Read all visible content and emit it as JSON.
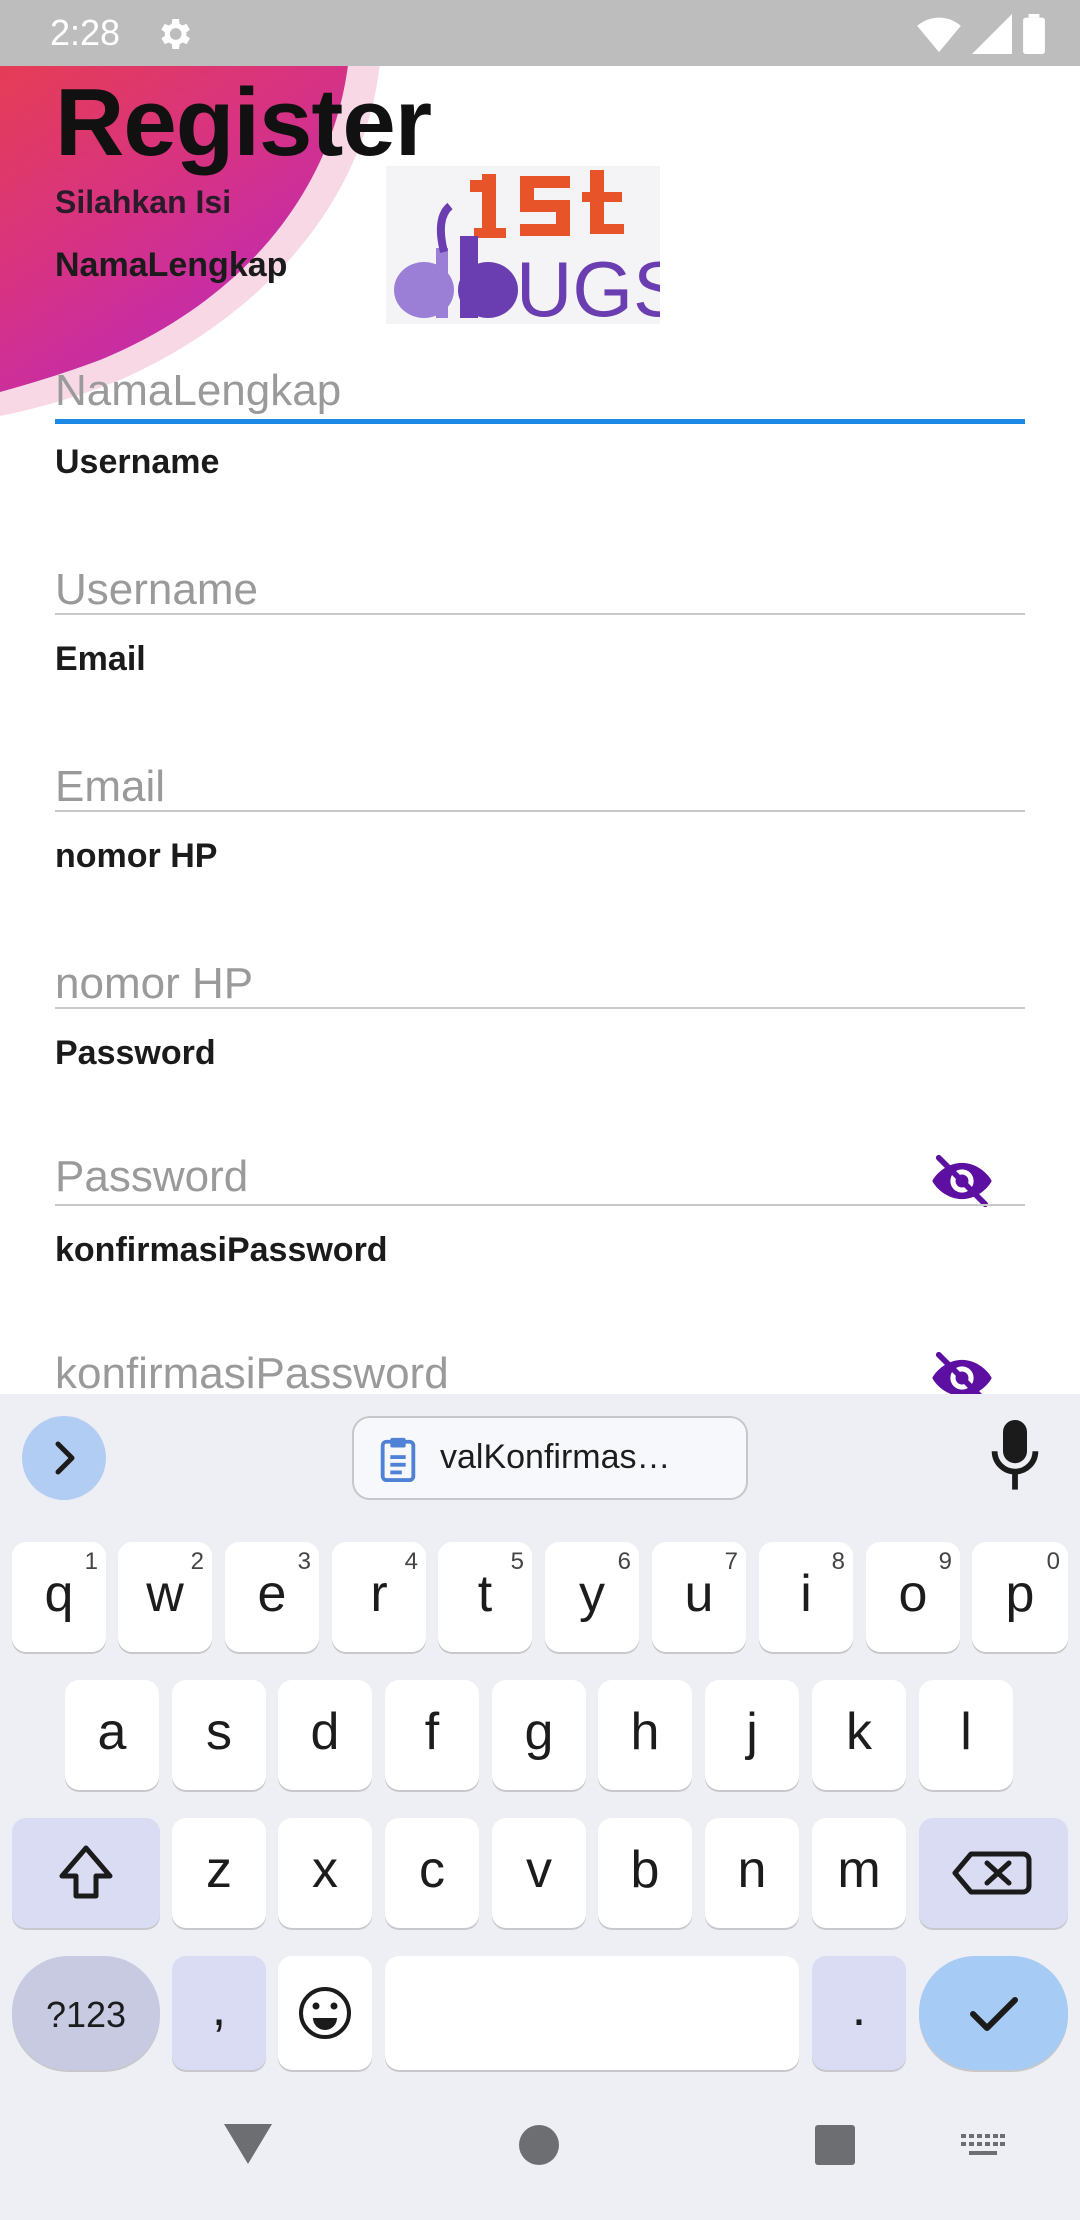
{
  "status_bar": {
    "time": "2:28"
  },
  "page": {
    "title": "Register",
    "subtitle": "Silahkan Isi"
  },
  "form": {
    "fields": [
      {
        "label": "NamaLengkap",
        "placeholder": "NamaLengkap"
      },
      {
        "label": "Username",
        "placeholder": "Username"
      },
      {
        "label": "Email",
        "placeholder": "Email"
      },
      {
        "label": "nomor HP",
        "placeholder": "nomor HP"
      },
      {
        "label": "Password",
        "placeholder": "Password"
      },
      {
        "label": "konfirmasiPassword",
        "placeholder": "konfirmasiPassword"
      }
    ]
  },
  "keyboard": {
    "clipboard_suggestion": "valKonfirmas…",
    "row1": [
      {
        "key": "q",
        "hint": "1"
      },
      {
        "key": "w",
        "hint": "2"
      },
      {
        "key": "e",
        "hint": "3"
      },
      {
        "key": "r",
        "hint": "4"
      },
      {
        "key": "t",
        "hint": "5"
      },
      {
        "key": "y",
        "hint": "6"
      },
      {
        "key": "u",
        "hint": "7"
      },
      {
        "key": "i",
        "hint": "8"
      },
      {
        "key": "o",
        "hint": "9"
      },
      {
        "key": "p",
        "hint": "0"
      }
    ],
    "row2": [
      "a",
      "s",
      "d",
      "f",
      "g",
      "h",
      "j",
      "k",
      "l"
    ],
    "row3": [
      "z",
      "x",
      "c",
      "v",
      "b",
      "n",
      "m"
    ],
    "symbols_label": "?123",
    "comma_label": ",",
    "period_label": "."
  },
  "colors": {
    "accent": "#1a8ae6",
    "eye_icon": "#5c0fa0",
    "blob_red": "#e8333b",
    "blob_magenta": "#c21ba8",
    "logo_orange": "#e8542a",
    "logo_purple": "#6a3db0"
  }
}
